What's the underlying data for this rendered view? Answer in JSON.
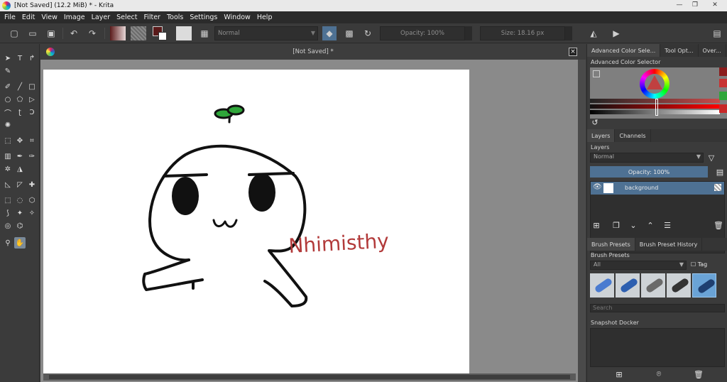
{
  "window": {
    "title": "[Not Saved]  (12.2 MiB)  * - Krita",
    "min_glyph": "—",
    "max_glyph": "❐",
    "close_glyph": "✕"
  },
  "menu": [
    "File",
    "Edit",
    "View",
    "Image",
    "Layer",
    "Select",
    "Filter",
    "Tools",
    "Settings",
    "Window",
    "Help"
  ],
  "toolbar": {
    "blend_mode": "Normal",
    "opacity_label": "Opacity: 100%",
    "size_label": "Size: 18.16 px"
  },
  "document": {
    "tab_title": "[Not Saved]  *",
    "close_glyph": "×",
    "drawing_text": "Nhimisthy"
  },
  "colors": {
    "accent": "#4e7193",
    "signature": "#b23a3a",
    "sprout": "#2fa63a"
  },
  "dock": {
    "top_tabs": [
      "Advanced Color Sele...",
      "Tool Opt...",
      "Over..."
    ],
    "color_selector_title": "Advanced Color Selector",
    "layer_tabs": [
      "Layers",
      "Channels"
    ],
    "layers_title": "Layers",
    "layer_blend": "Normal",
    "layer_opacity": "Opacity:  100%",
    "layers": [
      {
        "name": "background",
        "visible": true
      }
    ],
    "brush_tabs": [
      "Brush Presets",
      "Brush Preset History"
    ],
    "brush_presets_title": "Brush Presets",
    "brush_filter": "All",
    "tag_label": "Tag",
    "search_placeholder": "Search",
    "snapshot_title": "Snapshot Docker"
  }
}
